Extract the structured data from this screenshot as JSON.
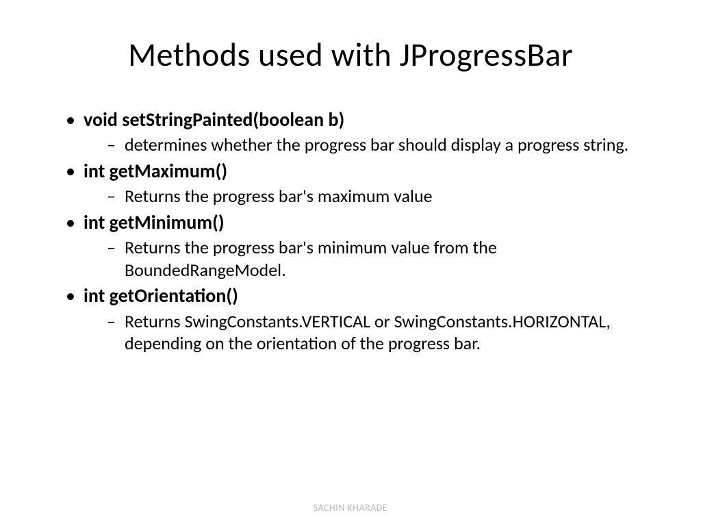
{
  "title": "Methods used with JProgressBar",
  "methods": [
    {
      "name": "void setStringPainted(boolean b)",
      "desc": "determines whether the progress bar should display a progress string."
    },
    {
      "name": "int getMaximum()",
      "desc": "Returns the progress bar's maximum value"
    },
    {
      "name": "int getMinimum()",
      "desc": "Returns the progress bar's minimum value from the BoundedRangeModel."
    },
    {
      "name": "int getOrientation()",
      "desc": "Returns SwingConstants.VERTICAL or SwingConstants.HORIZONTAL, depending on the orientation of the progress bar."
    }
  ],
  "footer": "SACHIN KHARADE"
}
